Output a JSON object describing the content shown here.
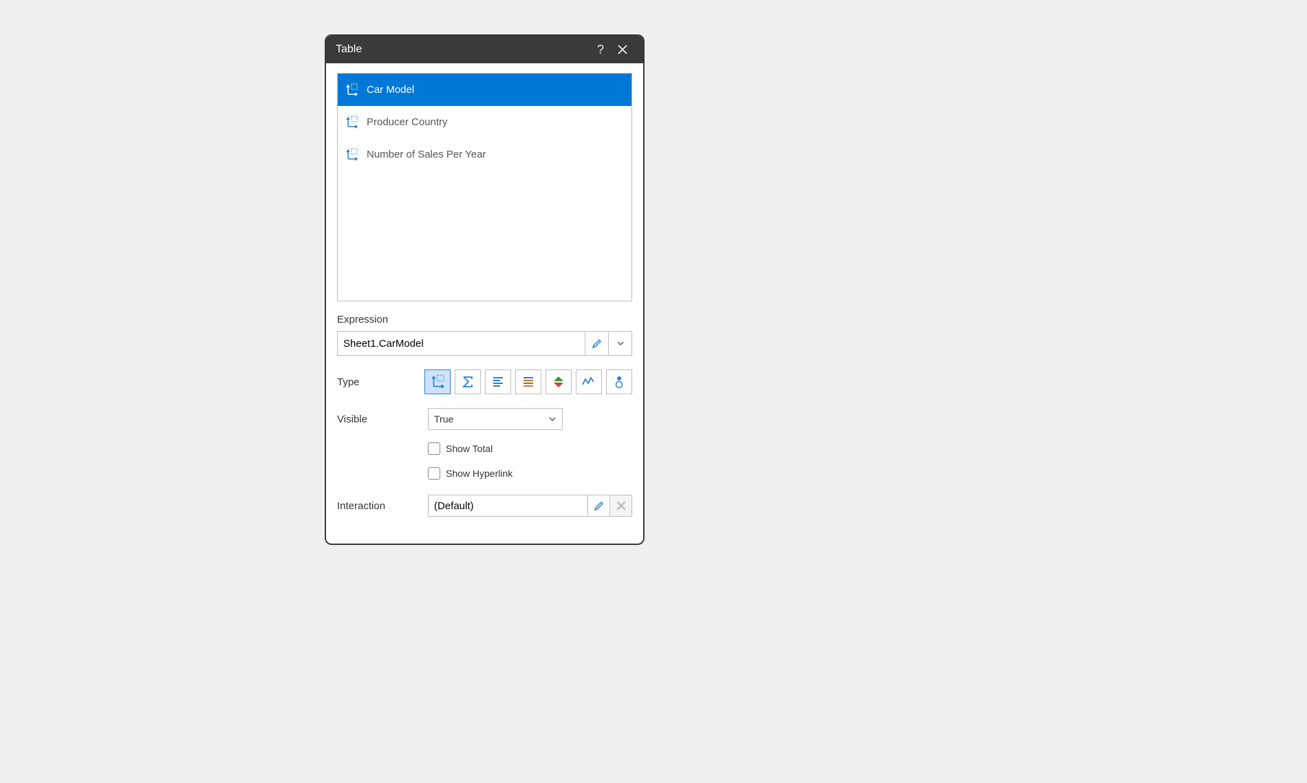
{
  "dialog": {
    "title": "Table",
    "fields": [
      {
        "label": "Car Model",
        "selected": true
      },
      {
        "label": "Producer Country",
        "selected": false
      },
      {
        "label": "Number of Sales Per Year",
        "selected": false
      }
    ],
    "expression_label": "Expression",
    "expression_value": "Sheet1.CarModel",
    "type_label": "Type",
    "type_buttons": [
      {
        "name": "dimension",
        "selected": true
      },
      {
        "name": "measure",
        "selected": false
      },
      {
        "name": "text-left",
        "selected": false
      },
      {
        "name": "text-stack",
        "selected": false
      },
      {
        "name": "delta",
        "selected": false
      },
      {
        "name": "sparkline",
        "selected": false
      },
      {
        "name": "gauge",
        "selected": false
      }
    ],
    "visible_label": "Visible",
    "visible_value": "True",
    "show_total_label": "Show Total",
    "show_hyperlink_label": "Show Hyperlink",
    "interaction_label": "Interaction",
    "interaction_value": "(Default)"
  }
}
